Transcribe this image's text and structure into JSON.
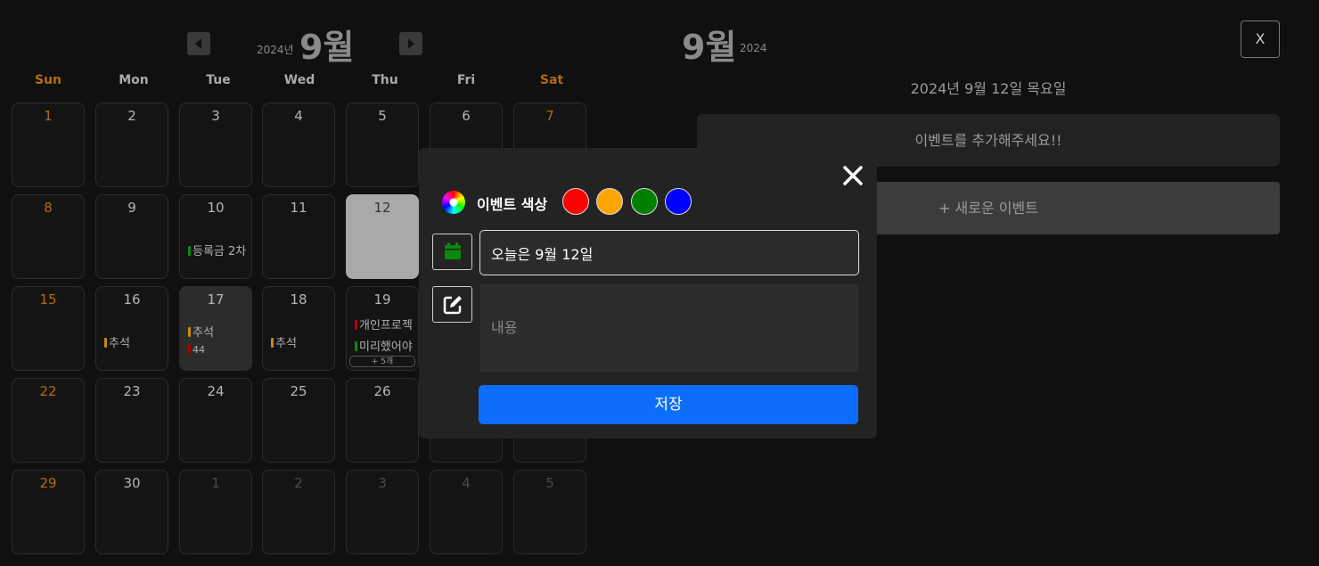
{
  "calendar": {
    "year_label": "2024년",
    "month_label": "9월",
    "weekdays": [
      "Sun",
      "Mon",
      "Tue",
      "Wed",
      "Thu",
      "Fri",
      "Sat"
    ],
    "weeks": [
      [
        {
          "d": "1",
          "t": "sun"
        },
        {
          "d": "2"
        },
        {
          "d": "3"
        },
        {
          "d": "4"
        },
        {
          "d": "5"
        },
        {
          "d": "6"
        },
        {
          "d": "7",
          "t": "sat"
        }
      ],
      [
        {
          "d": "8",
          "t": "sun"
        },
        {
          "d": "9"
        },
        {
          "d": "10",
          "events": [
            {
              "label": "등록금 2차",
              "color": "#0a8a0a"
            }
          ]
        },
        {
          "d": "11"
        },
        {
          "d": "12",
          "t": "today"
        },
        {
          "d": ""
        },
        {
          "d": "",
          "t": "sat"
        }
      ],
      [
        {
          "d": "15",
          "t": "sun"
        },
        {
          "d": "16",
          "events": [
            {
              "label": "추석",
              "color": "#c88a10"
            }
          ]
        },
        {
          "d": "17",
          "t": "hl",
          "events": [
            {
              "label": "추석",
              "color": "#c88a10"
            },
            {
              "label": "44",
              "color": "#a00"
            }
          ]
        },
        {
          "d": "18",
          "events": [
            {
              "label": "추석",
              "color": "#c88a10"
            }
          ]
        },
        {
          "d": "19",
          "events": [
            {
              "label": "개인프로젝",
              "color": "#b00"
            },
            {
              "label": "미리했어야",
              "color": "#0a8a0a"
            }
          ],
          "more": "+ 5개"
        },
        {
          "d": ""
        },
        {
          "d": "",
          "t": "sat"
        }
      ],
      [
        {
          "d": "22",
          "t": "sun"
        },
        {
          "d": "23"
        },
        {
          "d": "24"
        },
        {
          "d": "25"
        },
        {
          "d": "26"
        },
        {
          "d": ""
        },
        {
          "d": "",
          "t": "sat"
        }
      ],
      [
        {
          "d": "29",
          "t": "sun"
        },
        {
          "d": "30"
        },
        {
          "d": "1",
          "t": "other"
        },
        {
          "d": "2",
          "t": "other"
        },
        {
          "d": "3",
          "t": "other"
        },
        {
          "d": "4",
          "t": "other"
        },
        {
          "d": "5",
          "t": "other"
        }
      ]
    ]
  },
  "panel": {
    "month_label": "9월",
    "year_label": "2024",
    "close_label": "X",
    "selected_date": "2024년 9월 12일 목요일",
    "empty_message": "이벤트를 추가해주세요!!",
    "new_event_label": "+ 새로운 이벤트"
  },
  "modal": {
    "color_label": "이벤트 색상",
    "colors": [
      "#ff0000",
      "#ffa500",
      "#008000",
      "#0000ff"
    ],
    "title_value": "오늘은 9월 12일",
    "content_placeholder": "내용",
    "save_label": "저장",
    "accent": "#0d6efd",
    "calendar_icon_color": "#0a8a0a"
  }
}
